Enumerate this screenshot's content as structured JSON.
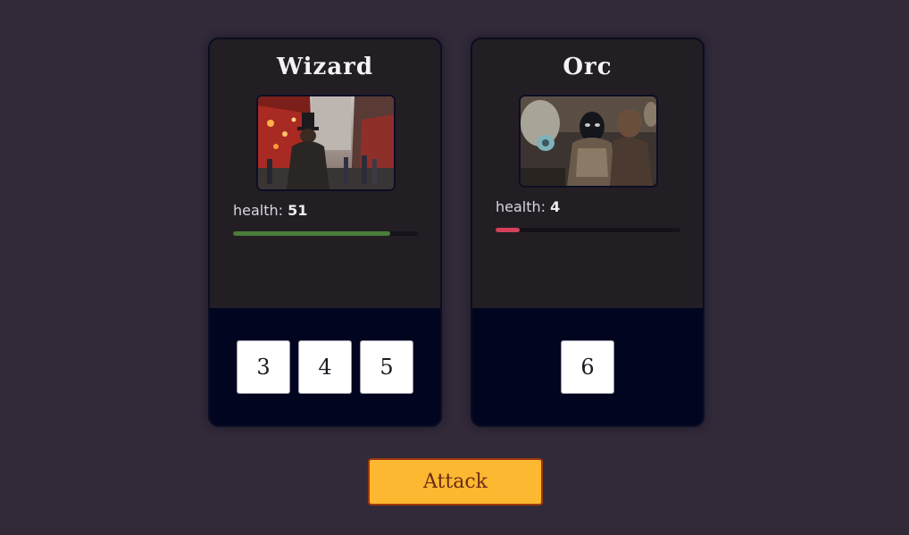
{
  "characters": [
    {
      "name": "Wizard",
      "image": "city-street-figure-in-top-hat",
      "health_label": "health:",
      "health_value": "51",
      "health_fraction": 0.85,
      "health_color": "#4a7d3a",
      "dice": [
        "3",
        "4",
        "5"
      ]
    },
    {
      "name": "Orc",
      "image": "armored-masked-warriors",
      "health_label": "health:",
      "health_value": "4",
      "health_fraction": 0.13,
      "health_color": "#d4405a",
      "dice": [
        "6"
      ]
    }
  ],
  "attack_button": {
    "label": "Attack",
    "color": "#fcb830"
  },
  "colors": {
    "background": "#322a39",
    "card_body": "#231e24",
    "dice_area": "#02051f"
  }
}
